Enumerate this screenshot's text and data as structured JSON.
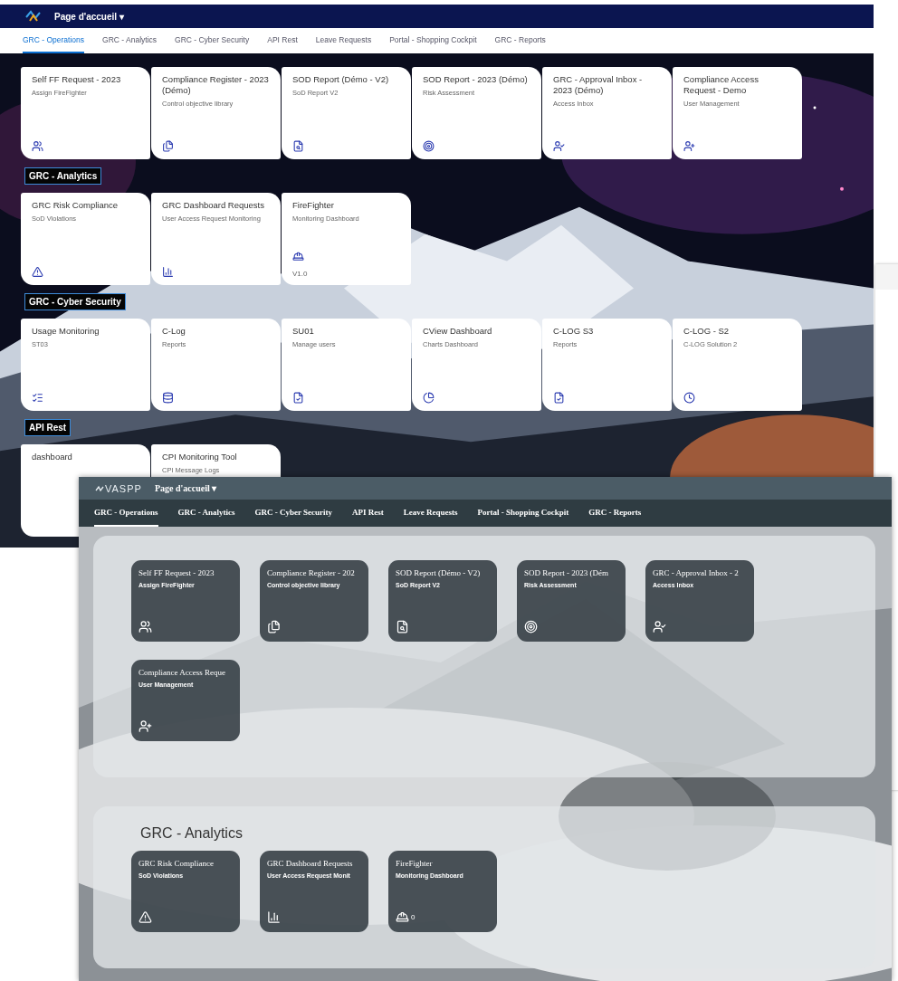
{
  "back_window": {
    "title": "Page d'accueil",
    "title_caret": "▾",
    "tabs": [
      {
        "label": "GRC - Operations",
        "selected": true
      },
      {
        "label": "GRC - Analytics",
        "selected": false
      },
      {
        "label": "GRC - Cyber Security",
        "selected": false
      },
      {
        "label": "API Rest",
        "selected": false
      },
      {
        "label": "Leave Requests",
        "selected": false
      },
      {
        "label": "Portal - Shopping Cockpit",
        "selected": false
      },
      {
        "label": "GRC - Reports",
        "selected": false
      }
    ],
    "groups": [
      {
        "tiles": [
          {
            "title": "Self FF Request - 2023",
            "subtitle": "Assign FireFighter"
          },
          {
            "title": "Compliance Register - 2023 (Démo)",
            "subtitle": "Control objective library"
          },
          {
            "title": "SOD Report (Démo - V2)",
            "subtitle": "SoD Report V2"
          },
          {
            "title": "SOD Report - 2023 (Démo)",
            "subtitle": "Risk Assessment"
          },
          {
            "title": "GRC - Approval Inbox - 2023 (Démo)",
            "subtitle": "Access Inbox"
          },
          {
            "title": "Compliance Access Request - Demo",
            "subtitle": "User Management"
          }
        ]
      },
      {
        "heading": "GRC - Analytics",
        "tiles": [
          {
            "title": "GRC Risk Compliance",
            "subtitle": "SoD Violations"
          },
          {
            "title": "GRC Dashboard Requests",
            "subtitle": "User Access Request Monitoring"
          },
          {
            "title": "FireFighter",
            "subtitle": "Monitoring Dashboard",
            "info": "V1.0"
          }
        ]
      },
      {
        "heading": "GRC - Cyber Security",
        "tiles": [
          {
            "title": "Usage Monitoring",
            "subtitle": "ST03"
          },
          {
            "title": "C-Log",
            "subtitle": "Reports"
          },
          {
            "title": "SU01",
            "subtitle": "Manage users"
          },
          {
            "title": "CView Dashboard",
            "subtitle": "Charts Dashboard"
          },
          {
            "title": "C-LOG S3",
            "subtitle": "Reports"
          },
          {
            "title": "C-LOG - S2",
            "subtitle": "C-LOG Solution 2"
          }
        ]
      },
      {
        "heading": "API Rest",
        "tiles": [
          {
            "title": "dashboard"
          },
          {
            "title": "CPI Monitoring Tool",
            "subtitle": "CPI Message Logs"
          }
        ]
      }
    ]
  },
  "front_window": {
    "logo": "VASPP",
    "title": "Page d'accueil",
    "title_caret": "▾",
    "tabs": [
      {
        "label": "GRC - Operations",
        "selected": true
      },
      {
        "label": "GRC - Analytics",
        "selected": false
      },
      {
        "label": "GRC - Cyber Security",
        "selected": false
      },
      {
        "label": "API Rest",
        "selected": false
      },
      {
        "label": "Leave Requests",
        "selected": false
      },
      {
        "label": "Portal - Shopping Cockpit",
        "selected": false
      },
      {
        "label": "GRC - Reports",
        "selected": false
      }
    ],
    "groups": [
      {
        "tiles": [
          {
            "title": "Self FF Request - 2023",
            "subtitle": "Assign FireFighter"
          },
          {
            "title": "Compliance Register - 202",
            "subtitle": "Control objective library"
          },
          {
            "title": "SOD Report (Démo - V2)",
            "subtitle": "SoD Report V2"
          },
          {
            "title": "SOD Report - 2023 (Dém",
            "subtitle": "Risk Assessment"
          },
          {
            "title": "GRC - Approval Inbox - 2",
            "subtitle": "Access Inbox"
          },
          {
            "title": "Compliance Access Reque",
            "subtitle": "User Management"
          }
        ]
      },
      {
        "heading": "GRC - Analytics",
        "tiles": [
          {
            "title": "GRC Risk Compliance",
            "subtitle": "SoD Violations"
          },
          {
            "title": "GRC Dashboard Requests",
            "subtitle": "User Access Request Monit"
          },
          {
            "title": "FireFighter",
            "subtitle": "Monitoring Dashboard",
            "info": "0"
          }
        ]
      }
    ]
  }
}
